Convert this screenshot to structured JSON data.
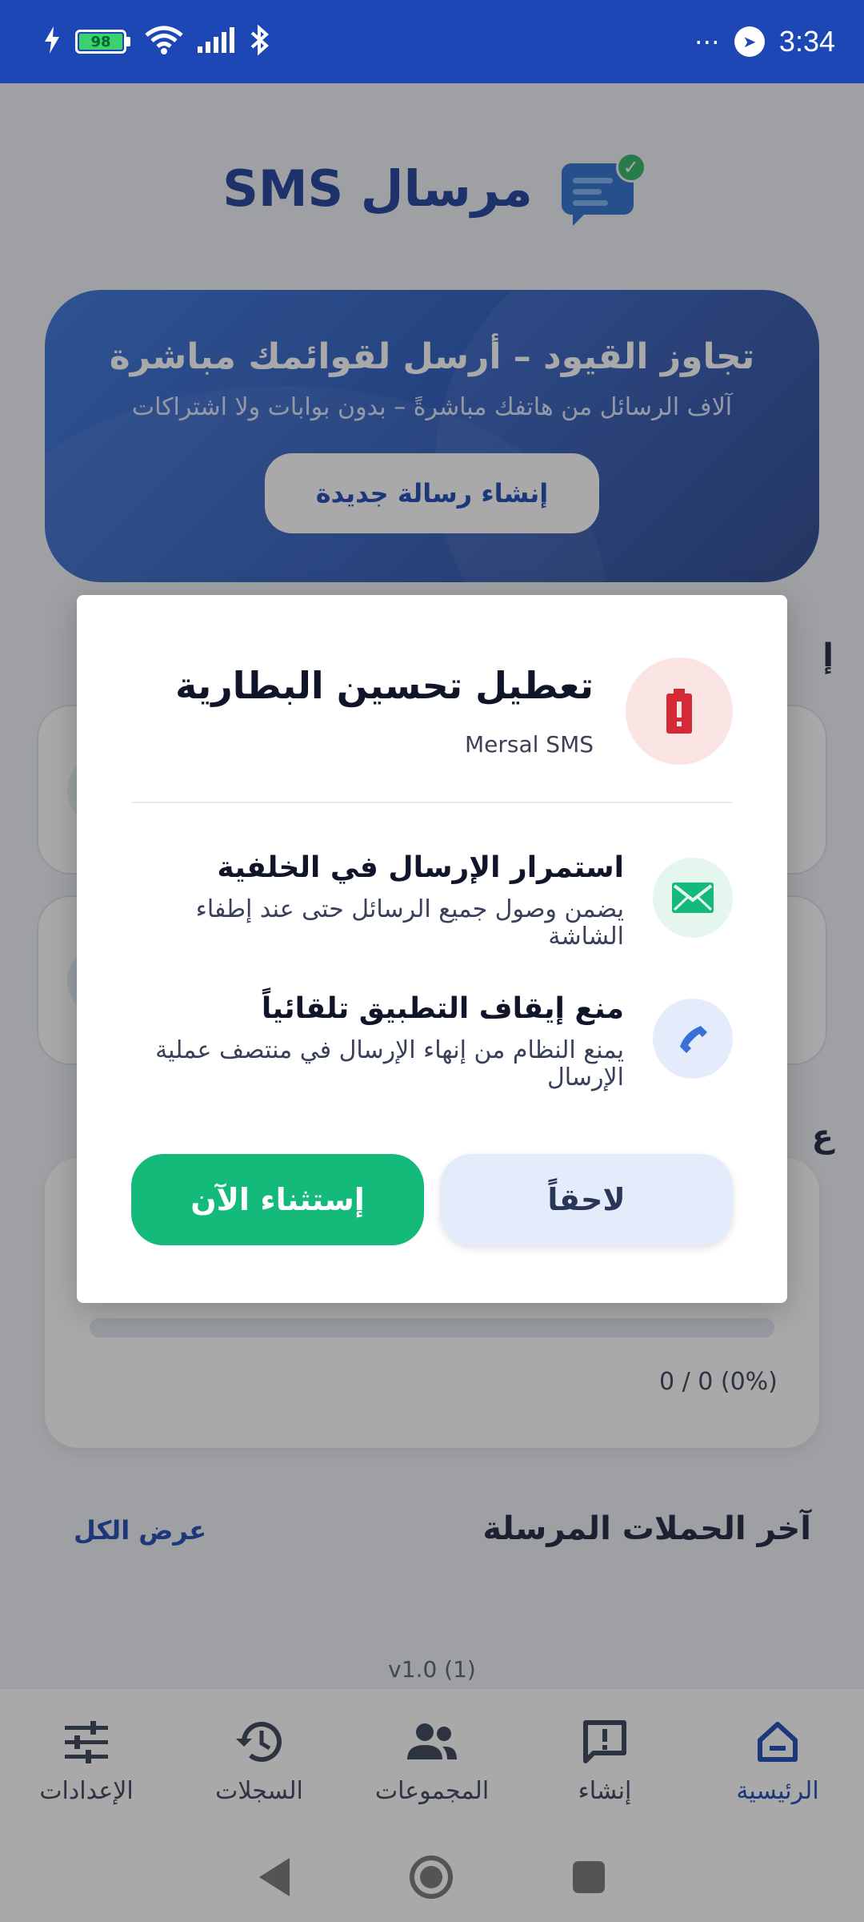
{
  "status_bar": {
    "time": "3:34",
    "battery": "98",
    "overflow": "⋯"
  },
  "app": {
    "title": "مرسال SMS"
  },
  "hero": {
    "title": "تجاوز القيود – أرسل لقوائمك مباشرة",
    "subtitle": "آلاف الرسائل من هاتفك مباشرةً – بدون بوابات ولا اشتراكات",
    "button_label": "إنشاء رسالة جديدة"
  },
  "background": {
    "section_fragment_1": "إ",
    "section_fragment_2": "ع",
    "progress": {
      "text": "0 / 0 (0%)",
      "percent": 0
    },
    "recent_title": "آخر الحملات المرسلة",
    "view_all": "عرض الكل",
    "version": "v1.0 (1)"
  },
  "dialog": {
    "title": "تعطيل تحسين البطارية",
    "subtitle": "Mersal SMS",
    "features": [
      {
        "title": "استمرار الإرسال في الخلفية",
        "description": "يضمن وصول جميع الرسائل حتى عند إطفاء الشاشة",
        "icon": "envelope-icon"
      },
      {
        "title": "منع إيقاف التطبيق تلقائياً",
        "description": "يمنع النظام من إنهاء الإرسال في منتصف عملية الإرسال",
        "icon": "phone-icon"
      }
    ],
    "later_label": "لاحقاً",
    "exempt_label": "إستثناء الآن"
  },
  "bottom_nav": {
    "items": [
      {
        "label": "الرئيسية",
        "icon": "home-icon",
        "active": true
      },
      {
        "label": "إنشاء",
        "icon": "compose-icon",
        "active": false
      },
      {
        "label": "المجموعات",
        "icon": "groups-icon",
        "active": false
      },
      {
        "label": "السجلات",
        "icon": "history-icon",
        "active": false
      },
      {
        "label": "الإعدادات",
        "icon": "settings-icon",
        "active": false
      }
    ]
  },
  "colors": {
    "primary": "#1d47b5",
    "success": "#14ba79",
    "danger": "#d42a35"
  }
}
